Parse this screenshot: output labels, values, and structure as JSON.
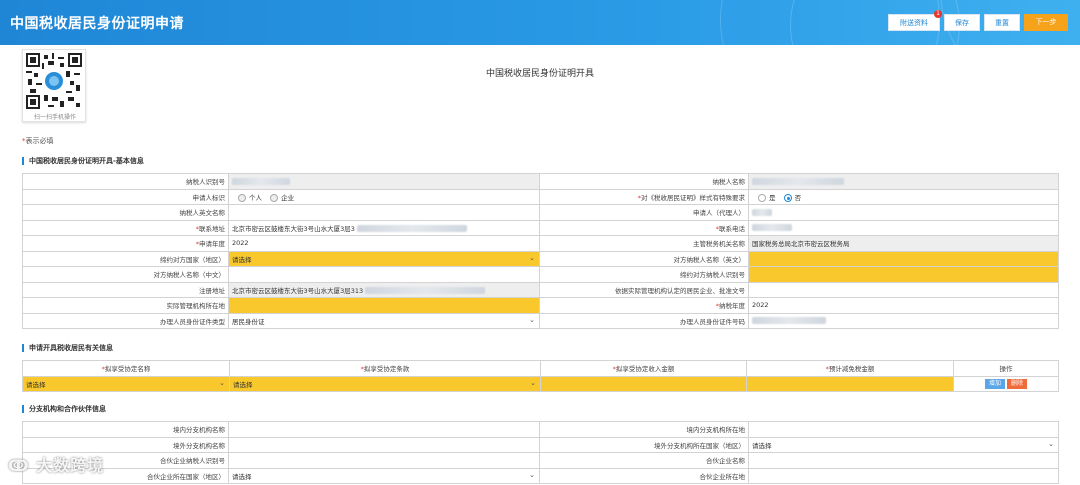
{
  "header": {
    "title": "中国税收居民身份证明申请",
    "buttons": [
      {
        "label": "附送资料"
      },
      {
        "label": "保存"
      },
      {
        "label": "重置"
      },
      {
        "label": "下一步"
      }
    ],
    "badge": "1"
  },
  "qr": {
    "caption": "扫一扫手机操作"
  },
  "page_title": "中国税收居民身份证明开具",
  "required_note": "表示必填",
  "basic": {
    "section_title": "中国税收居民身份证明开具-基本信息",
    "taxpayer_id_label": "纳税人识别号",
    "taxpayer_name_label": "纳税人名称",
    "applicant_type_label": "申请人标识",
    "applicant_type_opt1": "个人",
    "applicant_type_opt2": "企业",
    "special_req_label": "对《税收居民证明》样式有特殊要求",
    "special_req_yes": "是",
    "special_req_no": "否",
    "taxpayer_en_label": "纳税人英文名称",
    "agent_label": "申请人（代理人）",
    "contact_addr_label": "联系地址",
    "contact_addr_value": "北京市密云区鼓楼东大街3号山水大厦3层3",
    "contact_phone_label": "联系电话",
    "apply_year_label": "申请年度",
    "apply_year_value": "2022",
    "tax_office_label": "主管税务机关名称",
    "tax_office_value": "国家税务总局北京市密云区税务局",
    "treaty_country_label": "缔约对方国家（地区）",
    "treaty_country_value": "请选择",
    "counterpart_en_label": "对方纳税人名称（英文）",
    "counterpart_cn_label": "对方纳税人名称（中文）",
    "counterpart_id_label": "缔约对方纳税人识别号",
    "reg_addr_label": "注册地址",
    "reg_addr_value": "北京市密云区鼓楼东大街3号山水大厦3层313",
    "resident_basis_label": "依据实际管理机构认定的居民企业、批准文号",
    "mgmt_location_label": "实际管理机构所在地",
    "tax_year_label": "纳税年度",
    "tax_year_value": "2022",
    "handler_id_type_label": "办理人员身份证件类型",
    "handler_id_type_value": "居民身份证",
    "handler_id_no_label": "办理人员身份证件号码"
  },
  "treaty": {
    "section_title": "申请开具税收居民有关信息",
    "headers": [
      "拟享受协定名称",
      "拟享受协定条款",
      "拟享受协定收入金额",
      "预计减免税金额",
      "操作"
    ],
    "row": {
      "treaty_name": "请选择",
      "treaty_clause": "请选择"
    },
    "add_label": "增加",
    "delete_label": "删除"
  },
  "branch": {
    "section_title": "分支机构和合作伙伴信息",
    "domestic_branch_name_label": "境内分支机构名称",
    "domestic_branch_loc_label": "境内分支机构所在地",
    "foreign_branch_name_label": "境外分支机构名称",
    "foreign_branch_country_label": "境外分支机构所在国家（地区）",
    "foreign_branch_country_value": "请选择",
    "partner_id_label": "合伙企业纳税人识别号",
    "partner_name_label": "合伙企业名称",
    "partner_country_label": "合伙企业所在国家（地区）",
    "partner_country_value": "请选择",
    "partner_loc_label": "合伙企业所在地"
  },
  "watermark": "大数跨境"
}
